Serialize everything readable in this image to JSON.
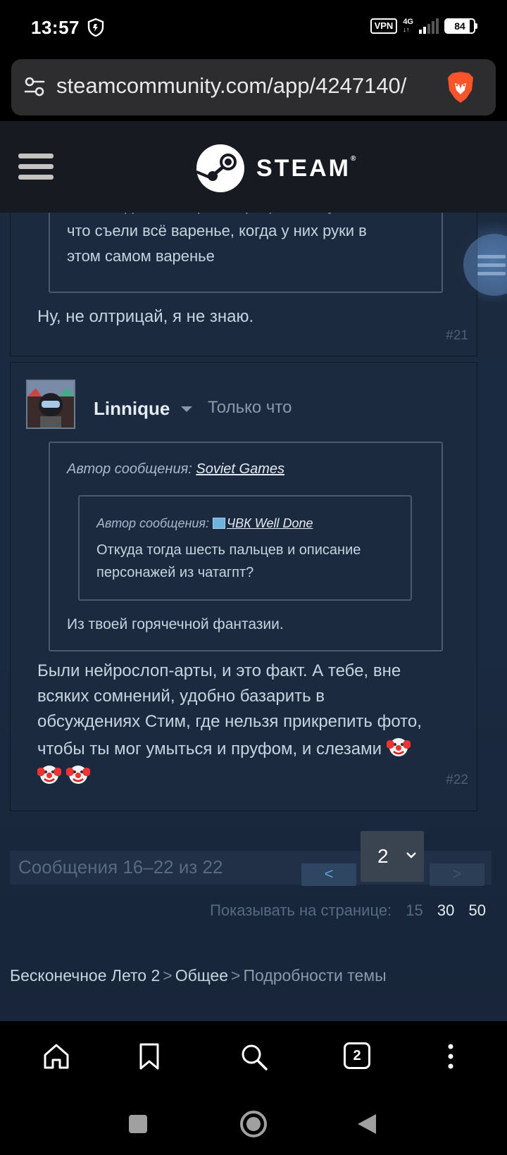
{
  "status": {
    "time": "13:57",
    "vpn": "VPN",
    "network": "4G",
    "battery": "84",
    "battery_level": 84
  },
  "browser": {
    "url": "steamcommunity.com/app/4247140/",
    "tab_count": "2"
  },
  "header": {
    "brand": "STEAM",
    "reg": "®"
  },
  "post21": {
    "quote_line1": "Это как дети, которые отрицают вину за то,",
    "quote_line2": "что съели всё варенье, когда у них руки в",
    "quote_line3": "этом самом варенье",
    "text": "Ну, не олтрицай, я не знаю.",
    "number": "#21"
  },
  "post22": {
    "author": "Linnique",
    "time": "Только что",
    "quote_author_label": "Автор сообщения:",
    "quote_author": "Soviet Games",
    "inner_quote_author_label": "Автор сообщения:",
    "inner_quote_author": "ЧВК Well Done",
    "inner_quote_line1": "Откуда тогда шесть пальцев и описание",
    "inner_quote_line2": "персонажей из чатагпт?",
    "quote_text": "Из твоей горячечной фантазии.",
    "line1": "Были нейрослоп-арты, и это факт. А тебе, вне",
    "line2": "всяких сомнений, удобно базарить в",
    "line3": "обсуждениях Стим, где нельзя прикрепить фото,",
    "line4": "чтобы ты мог умыться и пруфом, и слезами",
    "number": "#22"
  },
  "pagination": {
    "count": "Сообщения 16–22 из 22",
    "prev": "<",
    "next": ">",
    "page": "2",
    "per_page_label": "Показывать на странице:",
    "options": [
      "15",
      "30",
      "50"
    ]
  },
  "breadcrumb": {
    "game": "Бесконечное Лето 2",
    "sep": ">",
    "forum": "Общее",
    "current": "Подробности темы"
  },
  "colors": {
    "steam_header": "#171a21",
    "content_bg": "#1b2a3f",
    "post_bg": "#1c2a3f",
    "link_accent": "#66a0d8",
    "brave_orange": "#fb542b"
  },
  "icons": [
    "shield-icon",
    "tune-icon",
    "brave-lion-icon",
    "hamburger-icon",
    "steam-logo-icon",
    "clown-emoji",
    "home-icon",
    "bookmark-icon",
    "search-icon",
    "more-icon",
    "recents-icon",
    "home-circle-icon",
    "back-icon"
  ]
}
